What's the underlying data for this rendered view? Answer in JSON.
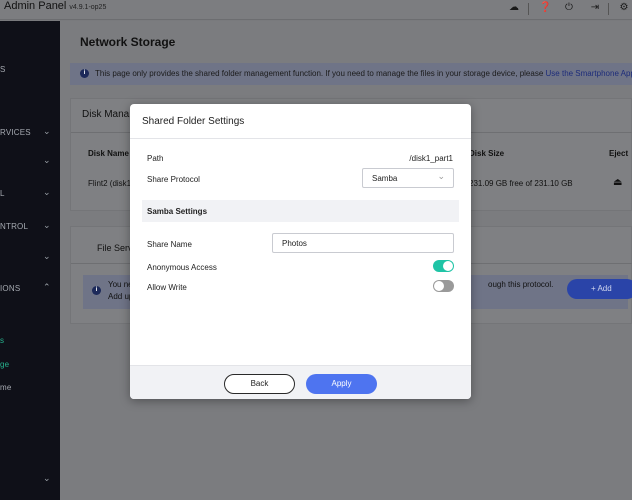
{
  "app": {
    "title": "Admin Panel",
    "version": "v4.9.1-op25"
  },
  "topbar_icons": [
    "cloud-icon",
    "help-icon",
    "power-icon",
    "logout-icon",
    "settings-icon"
  ],
  "sidebar": {
    "items": [
      {
        "label": "S",
        "chevron": false
      },
      {
        "label": "RVICES",
        "chevron": true
      },
      {
        "label": "",
        "chevron": true
      },
      {
        "label": "L",
        "chevron": true
      },
      {
        "label": "NTROL",
        "chevron": true
      },
      {
        "label": "",
        "chevron": true
      },
      {
        "label": "",
        "chevron": true
      },
      {
        "label": "IONS",
        "chevron": true
      },
      {
        "label": "s",
        "chevron": false
      },
      {
        "label": "ge",
        "chevron": false
      },
      {
        "label": "me",
        "chevron": false
      },
      {
        "label": "",
        "chevron": true
      }
    ]
  },
  "main": {
    "page_title": "Network Storage",
    "notice_text": "This page only provides the shared folder management function. If you need to manage the files in your storage device, please",
    "notice_link": "Use the Smartphone App",
    "disk_card": {
      "title": "Disk Mana",
      "columns": [
        "Disk Name",
        "Disk Size",
        "Eject"
      ],
      "row": {
        "name": "Flint2 (disk1",
        "size": "231.09 GB free of 231.10 GB"
      }
    },
    "file_card": {
      "tab": "File Serv",
      "info_line1": "You ne",
      "info_line2": "Add up",
      "info_line3": "ough this protocol.",
      "add_label": "Add"
    }
  },
  "modal": {
    "title": "Shared Folder Settings",
    "path_label": "Path",
    "path_value": "/disk1_part1",
    "protocol_label": "Share Protocol",
    "protocol_value": "Samba",
    "section_title": "Samba Settings",
    "share_name_label": "Share Name",
    "share_name_value": "Photos",
    "anonymous_label": "Anonymous Access",
    "anonymous_on": true,
    "allow_write_label": "Allow Write",
    "allow_write_on": false,
    "back_label": "Back",
    "apply_label": "Apply"
  },
  "colors": {
    "accent": "#4e74f0",
    "toggle_on": "#1fc4a6",
    "sidebar_bg": "#0f1018",
    "sidebar_active": "#27b38e"
  }
}
